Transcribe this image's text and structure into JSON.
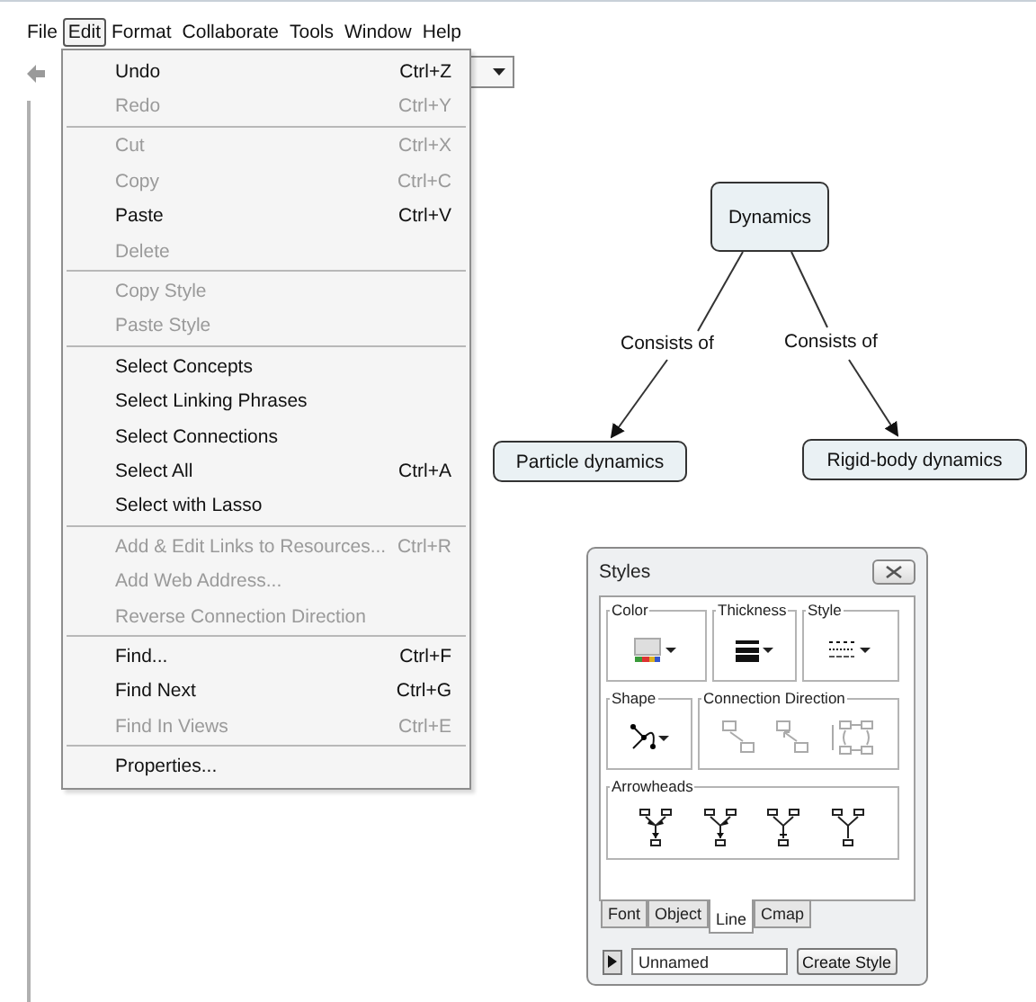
{
  "menu_bar": [
    {
      "label": "File",
      "selected": false
    },
    {
      "label": "Edit",
      "selected": true
    },
    {
      "label": "Format",
      "selected": false
    },
    {
      "label": "Collaborate",
      "selected": false
    },
    {
      "label": "Tools",
      "selected": false
    },
    {
      "label": "Window",
      "selected": false
    },
    {
      "label": "Help",
      "selected": false
    }
  ],
  "edit_menu": {
    "groups": [
      {
        "items": [
          {
            "label": "Undo",
            "shortcut": "Ctrl+Z",
            "disabled": false
          },
          {
            "label": "Redo",
            "shortcut": "Ctrl+Y",
            "disabled": true
          }
        ]
      },
      {
        "items": [
          {
            "label": "Cut",
            "shortcut": "Ctrl+X",
            "disabled": true
          },
          {
            "label": "Copy",
            "shortcut": "Ctrl+C",
            "disabled": true
          },
          {
            "label": "Paste",
            "shortcut": "Ctrl+V",
            "disabled": false
          },
          {
            "label": "Delete",
            "disabled": true
          }
        ]
      },
      {
        "items": [
          {
            "label": "Copy Style",
            "disabled": true
          },
          {
            "label": "Paste Style",
            "disabled": true
          }
        ]
      },
      {
        "items": [
          {
            "label": "Select Concepts",
            "disabled": false
          },
          {
            "label": "Select Linking Phrases",
            "disabled": false
          },
          {
            "label": "Select Connections",
            "disabled": false
          },
          {
            "label": "Select All",
            "shortcut": "Ctrl+A",
            "disabled": false
          },
          {
            "label": "Select with Lasso",
            "disabled": false
          }
        ]
      },
      {
        "items": [
          {
            "label": "Add & Edit Links to Resources...",
            "shortcut": "Ctrl+R",
            "disabled": true
          },
          {
            "label": "Add Web Address...",
            "disabled": true
          },
          {
            "label": "Reverse Connection Direction",
            "disabled": true
          }
        ]
      },
      {
        "items": [
          {
            "label": "Find...",
            "shortcut": "Ctrl+F",
            "disabled": false
          },
          {
            "label": "Find Next",
            "shortcut": "Ctrl+G",
            "disabled": false
          },
          {
            "label": "Find In Views",
            "shortcut": "Ctrl+E",
            "disabled": true
          }
        ]
      },
      {
        "items": [
          {
            "label": "Properties...",
            "disabled": false
          }
        ]
      }
    ]
  },
  "concept_map": {
    "concepts": [
      {
        "label": "Dynamics"
      },
      {
        "label": "Particle dynamics"
      },
      {
        "label": "Rigid-body dynamics"
      }
    ],
    "links": [
      {
        "label": "Consists of"
      },
      {
        "label": "Consists of"
      }
    ]
  },
  "styles_panel": {
    "title": "Styles",
    "groups": [
      {
        "legend": "Color",
        "kind": "color",
        "disabled": false
      },
      {
        "legend": "Thickness",
        "kind": "thickness",
        "disabled": false
      },
      {
        "legend": "Style",
        "kind": "style",
        "disabled": false
      },
      {
        "legend": "Shape",
        "kind": "shape",
        "disabled": false
      },
      {
        "legend": "Connection Direction",
        "kind": "direction",
        "disabled": true
      },
      {
        "legend": "Arrowheads",
        "kind": "arrowheads",
        "disabled": false
      }
    ],
    "tabs": [
      {
        "label": "Font",
        "selected": false
      },
      {
        "label": "Object",
        "selected": false
      },
      {
        "label": "Line",
        "selected": true
      },
      {
        "label": "Cmap",
        "selected": false
      }
    ],
    "style_name": "Unnamed",
    "create_button": "Create Style"
  }
}
